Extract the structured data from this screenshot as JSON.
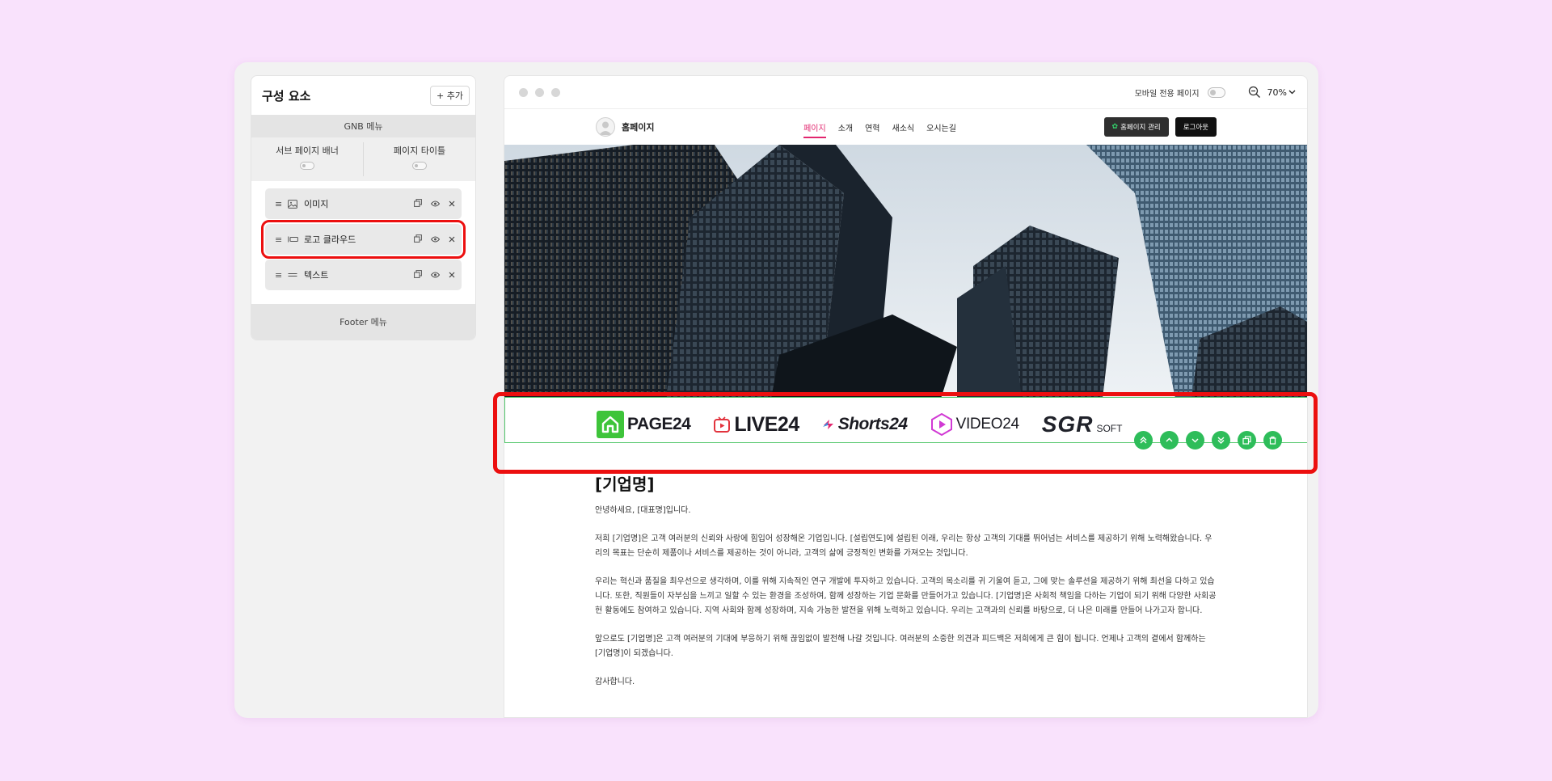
{
  "panel": {
    "title": "구성 요소",
    "add_label": "+ 추가",
    "gnb_label": "GNB 메뉴",
    "toggles": [
      {
        "label": "서브 페이지 배너"
      },
      {
        "label": "페이지 타이틀"
      }
    ],
    "items": [
      {
        "label": "이미지",
        "icon": "image-icon"
      },
      {
        "label": "로고 클라우드",
        "icon": "logo-cloud-icon"
      },
      {
        "label": "텍스트",
        "icon": "text-icon"
      }
    ],
    "footer_label": "Footer 메뉴"
  },
  "preview": {
    "mobile_label": "모바일 전용 페이지",
    "zoom": "70%",
    "site_name": "홈페이지",
    "menu": [
      "페이지",
      "소개",
      "연혁",
      "새소식",
      "오시는길"
    ],
    "active_menu": "페이지",
    "home_btn": "홈페이지 관리",
    "logout_btn": "로그아웃",
    "logos": [
      {
        "name": "PAGE24"
      },
      {
        "name": "LIVE24"
      },
      {
        "name": "Shorts24"
      },
      {
        "name": "VIDEO24"
      },
      {
        "name": "SGR",
        "sub": "SOFT"
      }
    ],
    "content": {
      "heading": "[기업명]",
      "paragraphs": [
        "안녕하세요, [대표명]입니다.",
        "저희 [기업명]은 고객 여러분의 신뢰와 사랑에 힘입어 성장해온 기업입니다. [설립연도]에 설립된 이래, 우리는 항상 고객의 기대를 뛰어넘는 서비스를 제공하기 위해 노력해왔습니다. 우리의 목표는 단순히 제품이나 서비스를 제공하는 것이 아니라, 고객의 삶에 긍정적인 변화를 가져오는 것입니다.",
        "우리는 혁신과 품질을 최우선으로 생각하며, 이를 위해 지속적인 연구 개발에 투자하고 있습니다. 고객의 목소리를 귀 기울여 듣고, 그에 맞는 솔루션을 제공하기 위해 최선을 다하고 있습니다. 또한, 직원들이 자부심을 느끼고 일할 수 있는 환경을 조성하여, 함께 성장하는 기업 문화를 만들어가고 있습니다. [기업명]은 사회적 책임을 다하는 기업이 되기 위해 다양한 사회공헌 활동에도 참여하고 있습니다. 지역 사회와 함께 성장하며, 지속 가능한 발전을 위해 노력하고 있습니다. 우리는 고객과의 신뢰를 바탕으로, 더 나은 미래를 만들어 나가고자 합니다.",
        "앞으로도 [기업명]은 고객 여러분의 기대에 부응하기 위해 끊임없이 발전해 나갈 것입니다. 여러분의 소중한 의견과 피드백은 저희에게 큰 힘이 됩니다. 언제나 고객의 곁에서 함께하는 [기업명]이 되겠습니다.",
        "감사합니다."
      ]
    }
  },
  "colors": {
    "background": "#f9e2fc",
    "highlight": "#ec0f0f",
    "accent_green": "#2ebd5a",
    "menu_active": "#e2266e"
  }
}
